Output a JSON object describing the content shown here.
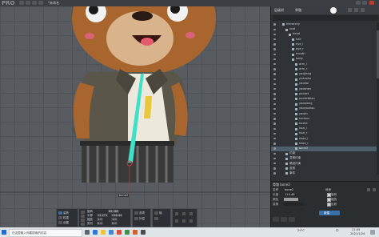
{
  "window": {
    "logo": "PRO",
    "title": "*未命名"
  },
  "panel": {
    "tabs": [
      "层级树",
      "骨骼"
    ],
    "tree_items": [
      "hierarchy",
      "root",
      "head",
      "hair",
      "eye_l",
      "eye_r",
      "mouth",
      "body",
      "arm_l",
      "arm_r",
      "yaojiang",
      "yuanzhu",
      "yaodai",
      "yaoshen",
      "pocket",
      "pocketbian",
      "yaoqiang",
      "yaoyoukou",
      "yaojin",
      "kunkou",
      "kuzhe",
      "kuzi_l",
      "kuzi_r",
      "shoe_l",
      "shoe_r",
      "bone2",
      "约束",
      "变换约束",
      "路径约束",
      "皮肤",
      "事件"
    ],
    "selected_item": "bone2",
    "properties": {
      "header": "骨骼 bone2",
      "name_label": "名称",
      "name_value": "bone2",
      "length_label": "长度",
      "length_value": "114.46",
      "color_label": "颜色",
      "inherit_label": "继承",
      "rotate_label": "旋转",
      "scale_label": "缩放",
      "reflect_label": "反射",
      "transform_label": "变换",
      "new_button": "新建"
    }
  },
  "viewport": {
    "bone_label": "bone2"
  },
  "toolbox": {
    "pose_label": "姿势",
    "weights_label": "权重",
    "create_label": "创建",
    "rotate_label": "旋转",
    "translate_label": "平移",
    "scale_label": "缩放",
    "shear_label": "剪切",
    "rotate_value": "89.389",
    "translate_x": "12.271",
    "translate_y": "218.44",
    "scale_x": "1.0",
    "scale_y": "1.0",
    "shear_x": "0.0",
    "shear_y": "0.0",
    "options_label": "选项",
    "compensate_label": "补偿",
    "axes_label": "轴"
  },
  "taskbar": {
    "search_placeholder": "在这里输入你要搜索的内容",
    "weather": "29°C",
    "time": "21:05",
    "date": "2021/1/24",
    "lang": "中"
  },
  "colors": {
    "bone": "#40e0c8",
    "selected_row": "#4f5e6b",
    "accent": "#3a6fa8"
  }
}
